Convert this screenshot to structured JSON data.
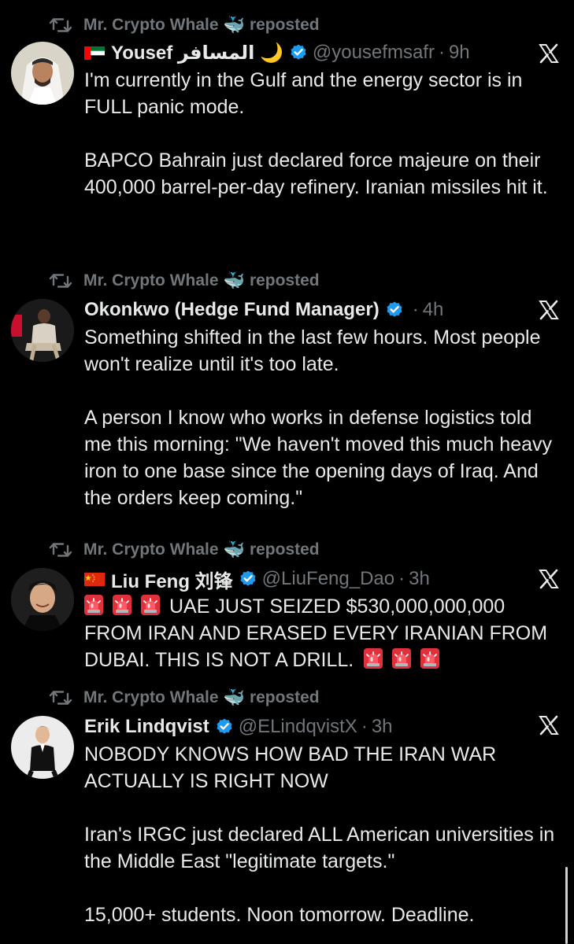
{
  "repost": {
    "user": "Mr. Crypto Whale",
    "emoji": "🐳",
    "label": "reposted"
  },
  "colors": {
    "background": "#000000",
    "text": "#e7e9ea",
    "muted": "#71767b",
    "verified": "#1d9bf0"
  },
  "posts": [
    {
      "flag": "uae-flag-icon",
      "name": "Yousef المسافر 🌙",
      "handle": "@yousefmsafr",
      "time": "9h",
      "text": "I'm currently in the Gulf and the energy sector is in FULL panic mode.\n\nBAPCO Bahrain just declared force majeure on their 400,000 barrel-per-day refinery. Iranian missiles hit it."
    },
    {
      "flag": "",
      "name": "Okonkwo (Hedge Fund Manager)",
      "handle": "",
      "time": "4h",
      "text": "Something shifted in the last few hours. Most people won't realize until it's too late.\n\nA person I know who works in defense logistics told me this morning: \"We haven't moved this much heavy iron to one base since the opening days of Iraq. And the orders keep coming.\""
    },
    {
      "flag": "china-flag-icon",
      "name": "Liu Feng 刘锋",
      "handle": "@LiuFeng_Dao",
      "time": "3h",
      "text_main": "UAE JUST SEIZED $530,000,000,000 FROM IRAN AND ERASED EVERY IRANIAN FROM DUBAI. THIS IS NOT A DRILL."
    },
    {
      "flag": "",
      "name": "Erik Lindqvist",
      "handle": "@ELindqvistX",
      "time": "3h",
      "text": "NOBODY KNOWS HOW BAD THE IRAN WAR ACTUALLY IS RIGHT NOW\n\nIran's IRGC just declared ALL American universities in the Middle East \"legitimate targets.\"\n\n15,000+ students. Noon tomorrow. Deadline."
    }
  ]
}
